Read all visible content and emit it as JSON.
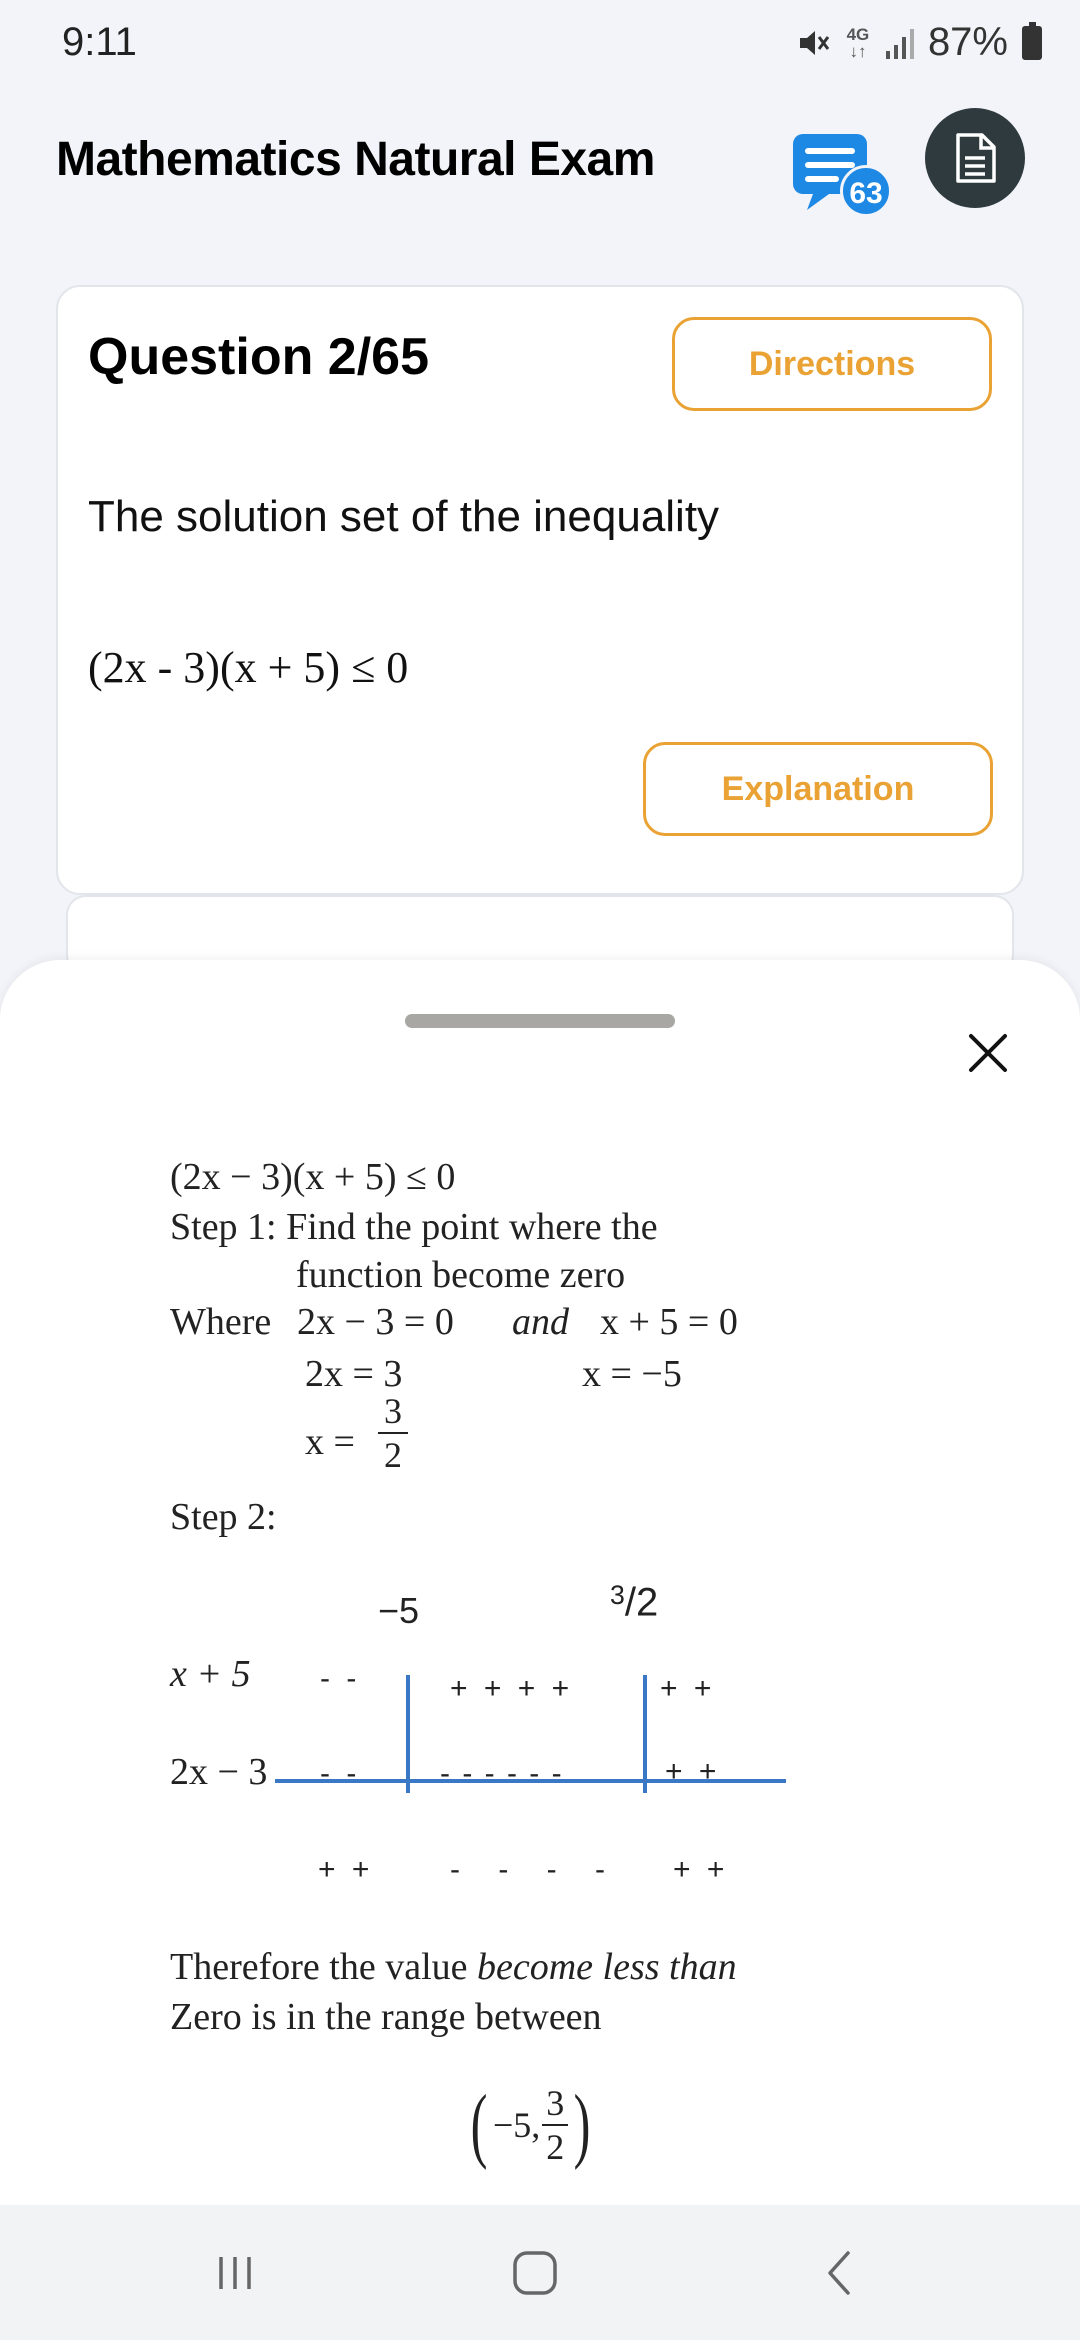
{
  "status_bar": {
    "time": "9:11",
    "network": "4G",
    "battery": "87%"
  },
  "header": {
    "title": "Mathematics Natural Exam",
    "badge_count": "63"
  },
  "question": {
    "number_label": "Question 2/65",
    "directions_label": "Directions",
    "text": "The solution set of the inequality",
    "inequality": "(2x - 3)(x + 5) ≤ 0",
    "explanation_label": "Explanation"
  },
  "explanation": {
    "line1": "(2x − 3)(x + 5) ≤ 0",
    "step1": "Step 1: Find the point where the",
    "step1b": "function become zero",
    "where_prefix": "Where",
    "where_eq1": "2x − 3 = 0",
    "where_and": "and",
    "where_eq2": "x + 5 = 0",
    "eq_2x": "2x = 3",
    "eq_x_neg5": "x = −5",
    "eq_x_prefix": "x =",
    "frac_num": "3",
    "frac_den": "2",
    "step2": "Step 2:",
    "sign_chart": {
      "label_neg5": "−5",
      "label_three": "3",
      "label_slash_two": "/2",
      "row1_label": "x + 5",
      "row1_left": "- -",
      "row1_mid": "+ + + +",
      "row1_right": "+ +",
      "row2_label": "2x − 3",
      "row2_left": "- -",
      "row2_mid": "- - - - - -",
      "row2_right": "+ +",
      "res_left": "+ +",
      "res_mid": "- - - -",
      "res_right": "+ +"
    },
    "conclusion1_a": "Therefore the value",
    "conclusion1_b": "become less than",
    "conclusion2": "Zero is in the range between",
    "answer_prefix": "−5,",
    "answer_num": "3",
    "answer_den": "2"
  },
  "nav": {
    "recent": "recent-apps",
    "home": "home",
    "back": "back"
  }
}
